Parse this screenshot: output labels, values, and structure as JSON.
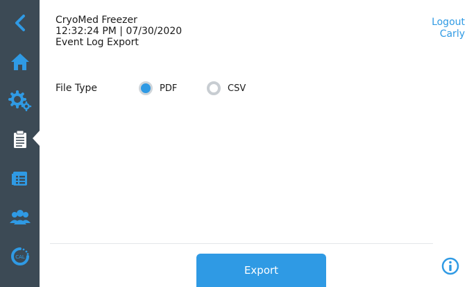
{
  "header": {
    "device_name": "CryoMed Freezer",
    "datetime": "12:32:24 PM | 07/30/2020",
    "page_title": "Event Log Export"
  },
  "user": {
    "logout_label": "Logout",
    "username": "Carly"
  },
  "sidebar": {
    "items": [
      {
        "icon": "back-chevron-icon"
      },
      {
        "icon": "home-icon"
      },
      {
        "icon": "gears-icon"
      },
      {
        "icon": "clipboard-icon",
        "active": true
      },
      {
        "icon": "calendar-list-icon"
      },
      {
        "icon": "users-icon"
      },
      {
        "icon": "calibration-icon",
        "text": "CAL"
      }
    ]
  },
  "form": {
    "file_type_label": "File Type",
    "options": [
      {
        "label": "PDF",
        "selected": true
      },
      {
        "label": "CSV",
        "selected": false
      }
    ]
  },
  "actions": {
    "export_label": "Export"
  },
  "colors": {
    "sidebar": "#3c4a55",
    "accent": "#2f9ae4"
  }
}
